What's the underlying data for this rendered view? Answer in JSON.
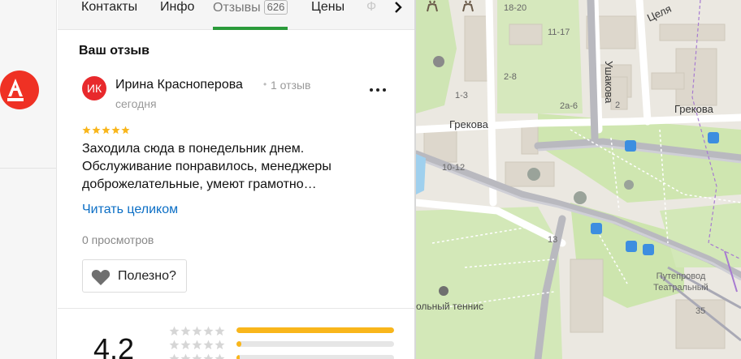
{
  "tabs": [
    {
      "label": "Контакты"
    },
    {
      "label": "Инфо"
    },
    {
      "label": "Отзывы",
      "count": "626"
    },
    {
      "label": "Цены"
    },
    {
      "label": "Ф"
    }
  ],
  "review_section": {
    "title": "Ваш отзыв"
  },
  "review": {
    "avatar_initials": "ИК",
    "author": "Ирина Красноперова",
    "author_reviews": "1 отзыв",
    "date": "сегодня",
    "stars": 5,
    "text": "Заходила сюда в понедельник днем. Обслуживание понравилось, менеджеры доброжелательные, умеют грамотно…",
    "read_more": "Читать целиком",
    "views": "0 просмотров",
    "useful_label": "Полезно?"
  },
  "rating_summary": {
    "value": "4.2",
    "distribution": [
      {
        "stars": 5,
        "share": 1.0
      },
      {
        "stars": 4,
        "share": 0.03
      },
      {
        "stars": 3,
        "share": 0.02
      }
    ]
  },
  "map": {
    "streets": [
      "Грекова",
      "Грекова",
      "Ушакова",
      "Целя"
    ],
    "houses": [
      "18-20",
      "11-17",
      "2-8",
      "1-3",
      "2а-6",
      "2",
      "10-12",
      "13",
      "35"
    ],
    "places": [
      "Путепровод Театральный"
    ],
    "partial_labels": [
      "ольный теннис"
    ]
  },
  "colors": {
    "accent_green": "#2a9a3a",
    "link": "#0b6ec5",
    "star": "#f9b61b",
    "brand_red": "#ef3124"
  }
}
